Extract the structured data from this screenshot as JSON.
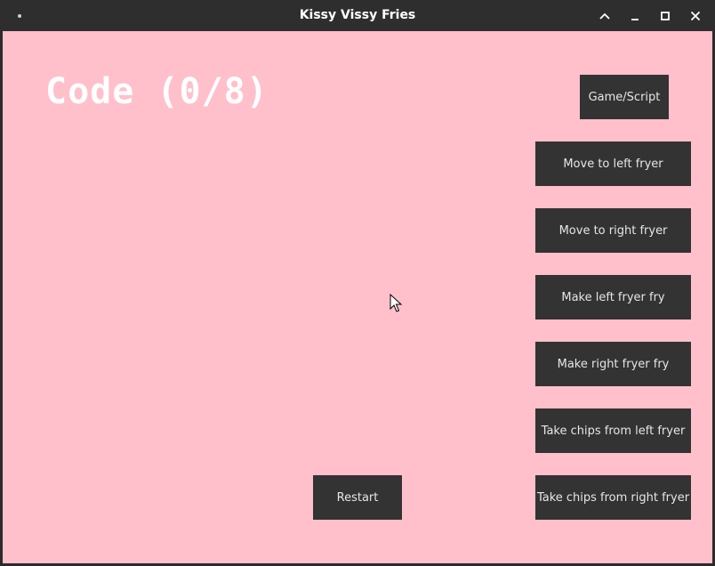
{
  "window": {
    "title": "Kissy Vissy Fries"
  },
  "game": {
    "code_label": "Code (0/8)",
    "buttons": {
      "game_script": "Game/Script",
      "move_left": "Move to left fryer",
      "move_right": "Move to right fryer",
      "fry_left": "Make left fryer fry",
      "fry_right": "Make right fryer fry",
      "chips_left": "Take chips from left fryer",
      "chips_right": "Take chips from right fryer",
      "restart": "Restart"
    }
  },
  "colors": {
    "background": "#ffc0cb",
    "button": "#333333",
    "button_text": "#e6e6e6",
    "titlebar": "#2e2e2e"
  },
  "icons": {
    "window_menu": "menu-dot-icon",
    "maximize_up": "chevron-up-icon",
    "minimize": "minimize-icon",
    "restore": "maximize-icon",
    "close": "close-icon",
    "pointer": "mouse-pointer-icon"
  }
}
